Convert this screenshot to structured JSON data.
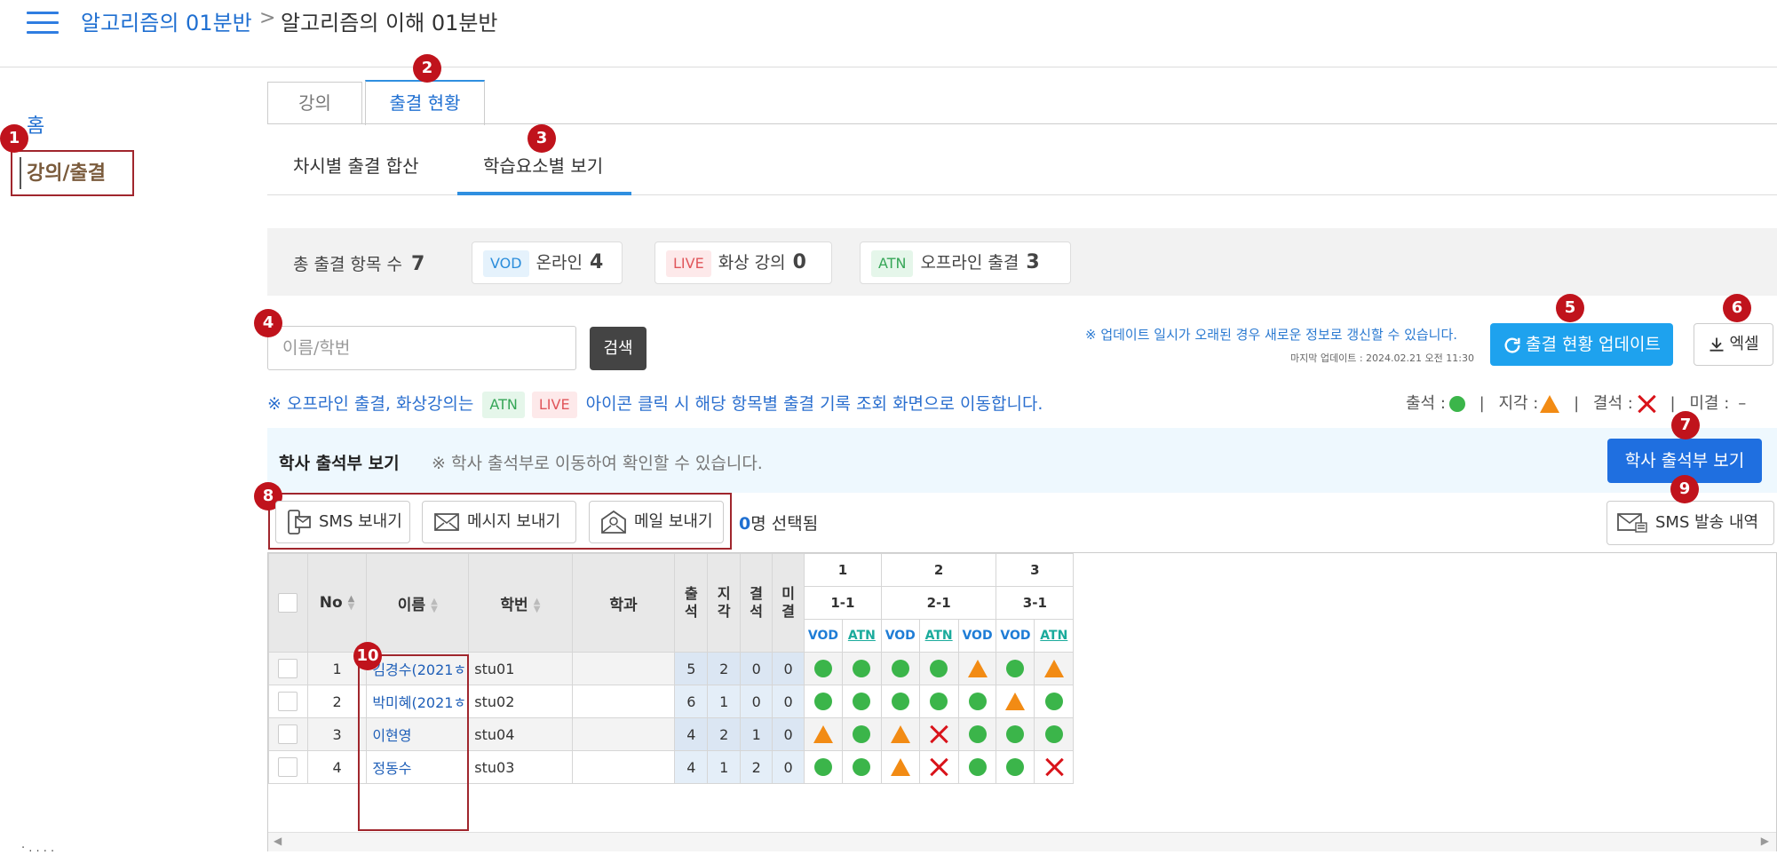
{
  "breadcrumb": {
    "course": "알고리즘의 01분반",
    "separator": ">",
    "page": "알고리즘의 이해 01분반"
  },
  "sidebar": {
    "home": "홈",
    "selected": "강의/출결"
  },
  "badges": {
    "b1": "1",
    "b2": "2",
    "b3": "3",
    "b4": "4",
    "b5": "5",
    "b6": "6",
    "b7": "7",
    "b8": "8",
    "b9": "9",
    "b10": "10"
  },
  "tabs": {
    "lecture": "강의",
    "attendance": "출결 현황"
  },
  "subtabs": {
    "by_session": "차시별 출결 합산",
    "by_element": "학습요소별 보기"
  },
  "summary": {
    "total_label": "총 출결 항목 수",
    "total": "7",
    "vod_tag": "VOD",
    "vod_label": "온라인",
    "vod_count": "4",
    "live_tag": "LIVE",
    "live_label": "화상 강의",
    "live_count": "0",
    "atn_tag": "ATN",
    "atn_label": "오프라인 출결",
    "atn_count": "3"
  },
  "search": {
    "placeholder": "이름/학번",
    "button": "검색"
  },
  "update": {
    "note": "※ 업데이트 일시가 오래된 경우 새로운 정보로 갱신할 수 있습니다.",
    "last": "마지막 업데이트 : 2024.02.21 오전 11:30",
    "button": "출결 현황 업데이트",
    "excel": "엑셀"
  },
  "info": {
    "prefix": "※ 오프라인 출결, 화상강의는",
    "atn": "ATN",
    "live": "LIVE",
    "suffix": "아이콘 클릭 시 해당 항목별 출결 기록 조회 화면으로 이동합니다."
  },
  "legend": {
    "present": "출석 :",
    "late": "지각 :",
    "absent": "결석 :",
    "undecided": "미결 :",
    "undecided_mark": "–",
    "sep": "|"
  },
  "academic": {
    "title": "학사 출석부 보기",
    "note": "※ 학사 출석부로 이동하여 확인할 수 있습니다.",
    "button": "학사 출석부 보기"
  },
  "actions": {
    "sms": "SMS 보내기",
    "message": "메시지 보내기",
    "mail": "메일 보내기",
    "selected_count": "0",
    "selected_suffix": "명 선택됨",
    "sms_history": "SMS 발송 내역"
  },
  "table": {
    "headers": {
      "no": "No",
      "name": "이름",
      "id": "학번",
      "dept": "학과",
      "present": "출석",
      "late": "지각",
      "absent": "결석",
      "undecided": "미결"
    },
    "weeks": [
      "1",
      "2",
      "3"
    ],
    "sessions": [
      "1-1",
      "2-1",
      "3-1"
    ],
    "item_types": [
      "VOD",
      "ATN",
      "VOD",
      "ATN",
      "VOD",
      "VOD",
      "ATN"
    ],
    "rows": [
      {
        "no": "1",
        "name": "김경수(2021ㅎ",
        "id": "stu01",
        "dept": "",
        "present": "5",
        "late": "2",
        "absent": "0",
        "undecided": "0",
        "marks": [
          "present",
          "present",
          "present",
          "present",
          "late",
          "present",
          "late"
        ]
      },
      {
        "no": "2",
        "name": "박미혜(2021ㅎ",
        "id": "stu02",
        "dept": "",
        "present": "6",
        "late": "1",
        "absent": "0",
        "undecided": "0",
        "marks": [
          "present",
          "present",
          "present",
          "present",
          "present",
          "late",
          "present"
        ]
      },
      {
        "no": "3",
        "name": "이현영",
        "id": "stu04",
        "dept": "",
        "present": "4",
        "late": "2",
        "absent": "1",
        "undecided": "0",
        "marks": [
          "late",
          "present",
          "late",
          "absent",
          "present",
          "present",
          "present"
        ]
      },
      {
        "no": "4",
        "name": "정동수",
        "id": "stu03",
        "dept": "",
        "present": "4",
        "late": "1",
        "absent": "2",
        "undecided": "0",
        "marks": [
          "present",
          "present",
          "late",
          "absent",
          "present",
          "present",
          "absent"
        ]
      }
    ]
  },
  "footer": {
    "partial": "· . . . ."
  },
  "colors": {
    "primary": "#1f6fd1",
    "update": "#1ea2ee",
    "highlight": "#a0262d",
    "present": "#3bb54a",
    "late": "#f28b14",
    "absent": "#d9141b"
  }
}
